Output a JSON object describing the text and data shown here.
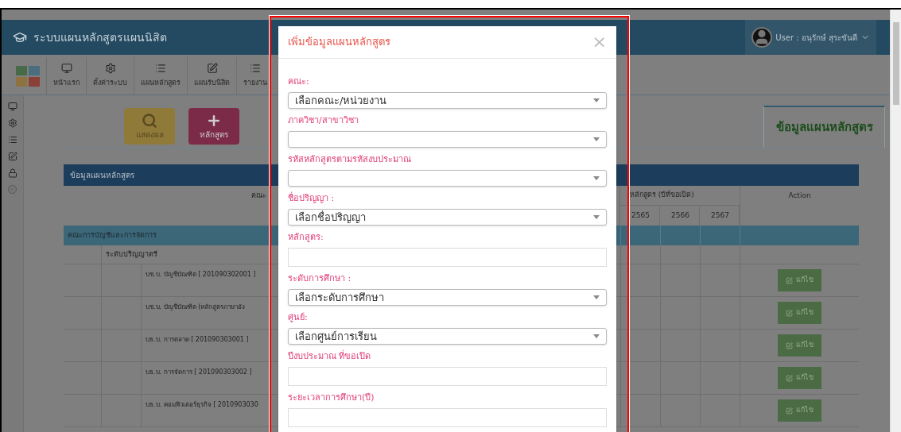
{
  "header": {
    "title": "ระบบแผนหลักสูตรแผนนิสิต",
    "user": "User : อนุรักษ์ สุระขันดี"
  },
  "toolbar": [
    {
      "label": "หน้าแรก"
    },
    {
      "label": "ตั้งค่าระบบ"
    },
    {
      "label": "แผนหลักสูตร"
    },
    {
      "label": "แผนรับนิสิต"
    },
    {
      "label": "รายงาน"
    }
  ],
  "action_buttons": [
    {
      "label": "แสดงผล",
      "kind": "search"
    },
    {
      "label": "หลักสูตร",
      "kind": "add"
    }
  ],
  "tab": {
    "label": "ข้อมูลแผนหลักสูตร"
  },
  "table": {
    "title": "ข้อมูลแผนหลักสูตร",
    "faculty_header": "คณะ",
    "years_header": "หลักสูตร (ปีที่ขอเปิด)",
    "years": [
      "2565",
      "2566",
      "2567"
    ],
    "action_header": "Action",
    "group": "คณะการบัญชีและการจัดการ",
    "level": "ระดับปริญญาตรี",
    "rows": [
      {
        "name": "บช.บ. บัญชีบัณฑิต [ 201090302001 ]",
        "button": "แก้ไข"
      },
      {
        "name": "บช.บ. บัญชีบัณฑิต (หลักสูตรภาษาอัง",
        "button": "แก้ไข"
      },
      {
        "name": "บธ.บ. การตลาด [ 201090303001 ]",
        "button": "แก้ไข"
      },
      {
        "name": "บธ.บ. การจัดการ [ 201090303002 ]",
        "button": "แก้ไข"
      },
      {
        "name": "บธ.บ. คอมพิวเตอร์ธุรกิจ [ 2010903030",
        "button": "แก้ไข"
      }
    ]
  },
  "modal": {
    "title": "เพิ่มข้อมูลแผนหลักสูตร",
    "close": "×",
    "fields": [
      {
        "label": "คณะ:",
        "kind": "select",
        "value": "เลือกคณะ/หน่วยงาน"
      },
      {
        "label": "ภาควิชา/สาขาวิชา",
        "kind": "select"
      },
      {
        "label": "รหัสหลักสูตรตามรหัสงบประมาณ",
        "kind": "select"
      },
      {
        "label": "ชื่อปริญญา :",
        "kind": "select",
        "value": "เลือกชื่อปริญญา"
      },
      {
        "label": "หลักสูตร:",
        "kind": "text"
      },
      {
        "label": "ระดับการศึกษา :",
        "kind": "select",
        "value": "เลือกระดับการศึกษา"
      },
      {
        "label": "ศูนย์:",
        "kind": "select",
        "value": "เลือกศูนย์การเรียน"
      },
      {
        "label": "ปีงบประมาณ ที่ขอเปิด",
        "kind": "text"
      },
      {
        "label": "ระยะเวลาการศึกษา(ปี)",
        "kind": "text"
      }
    ]
  }
}
